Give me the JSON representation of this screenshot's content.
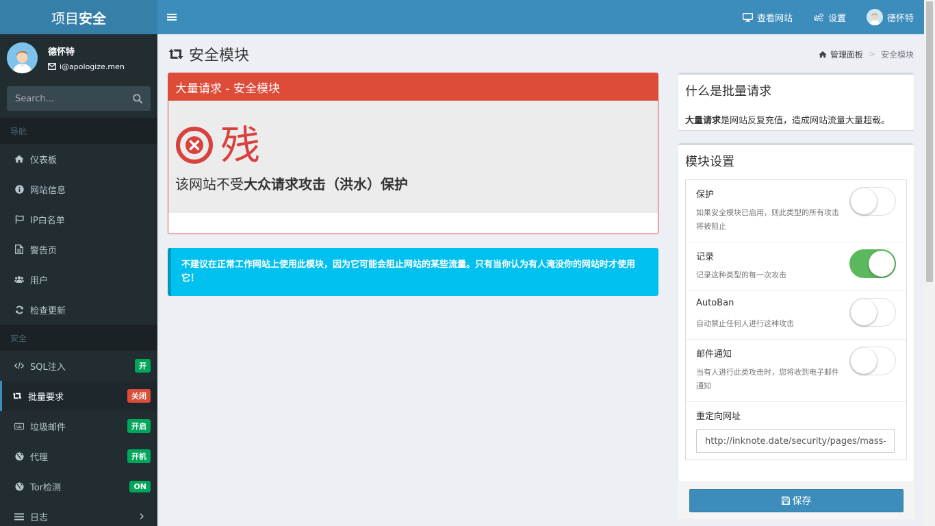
{
  "sidebar": {
    "logo_light": "项目",
    "logo_bold": "安全",
    "user": {
      "name": "德怀特",
      "email": "i@apologize.men"
    },
    "search": {
      "placeholder": "Search..."
    },
    "header_nav": "导航",
    "header_security": "安全",
    "nav_items": [
      {
        "label": "仪表板",
        "icon": "home-icon"
      },
      {
        "label": "网站信息",
        "icon": "info-icon"
      },
      {
        "label": "IP白名单",
        "icon": "flag-icon"
      },
      {
        "label": "警告页",
        "icon": "file-icon"
      },
      {
        "label": "用户",
        "icon": "users-icon"
      },
      {
        "label": "检查更新",
        "icon": "refresh-icon"
      }
    ],
    "security_items": [
      {
        "label": "SQL注入",
        "icon": "code-icon",
        "badge": "开",
        "badge_color": "#00a65a"
      },
      {
        "label": "批量要求",
        "icon": "retweet-icon",
        "badge": "关闭",
        "badge_color": "#dd4b39"
      },
      {
        "label": "垃圾邮件",
        "icon": "keyboard-icon",
        "badge": "开启",
        "badge_color": "#00a65a"
      },
      {
        "label": "代理",
        "icon": "globe-icon",
        "badge": "开机",
        "badge_color": "#00a65a"
      },
      {
        "label": "Tor检测",
        "icon": "globe-icon",
        "badge": "ON",
        "badge_color": "#00a65a"
      },
      {
        "label": "日志",
        "icon": "list-icon"
      }
    ]
  },
  "topbar": {
    "view_site": "查看网站",
    "settings": "设置",
    "user_name": "德怀特"
  },
  "content": {
    "title": "安全模块",
    "breadcrumb": {
      "home": "管理面板",
      "current": "安全模块"
    }
  },
  "status_box": {
    "header": "大量请求 - 安全模块",
    "status": "残",
    "desc_prefix": "该网站不受",
    "desc_bold": "大众请求攻击（洪水）保护"
  },
  "callout": {
    "text": "不建议在正常工作网站上使用此模块，因为它可能会阻止网站的某些流量。只有当你认为有人淹没你的网站时才使用它！"
  },
  "info_box": {
    "title": "什么是批量请求",
    "desc_bold": "大量请求",
    "desc_rest": "是网站反复充值，造成网站流量大量超载。"
  },
  "settings_box": {
    "title": "模块设置",
    "rows": [
      {
        "label": "保护",
        "desc": "如果安全模块已启用，则此类型的所有攻击将被阻止",
        "on": false
      },
      {
        "label": "记录",
        "desc": "记录这种类型的每一次攻击",
        "on": true
      },
      {
        "label": "AutoBan",
        "desc": "自动禁止任何人进行这种攻击",
        "on": false
      },
      {
        "label": "邮件通知",
        "desc": "当有人进行此类攻击时，您将收到电子邮件通知",
        "on": false
      }
    ],
    "redirect_label": "重定向网址",
    "redirect_value": "http://inknote.date/security/pages/mass-requests.html",
    "save_label": "保存"
  },
  "colors": {
    "brand": "#3c8dbc",
    "danger": "#dd4b39",
    "success": "#00a65a",
    "info": "#00c0ef",
    "sidebar": "#222d32"
  }
}
